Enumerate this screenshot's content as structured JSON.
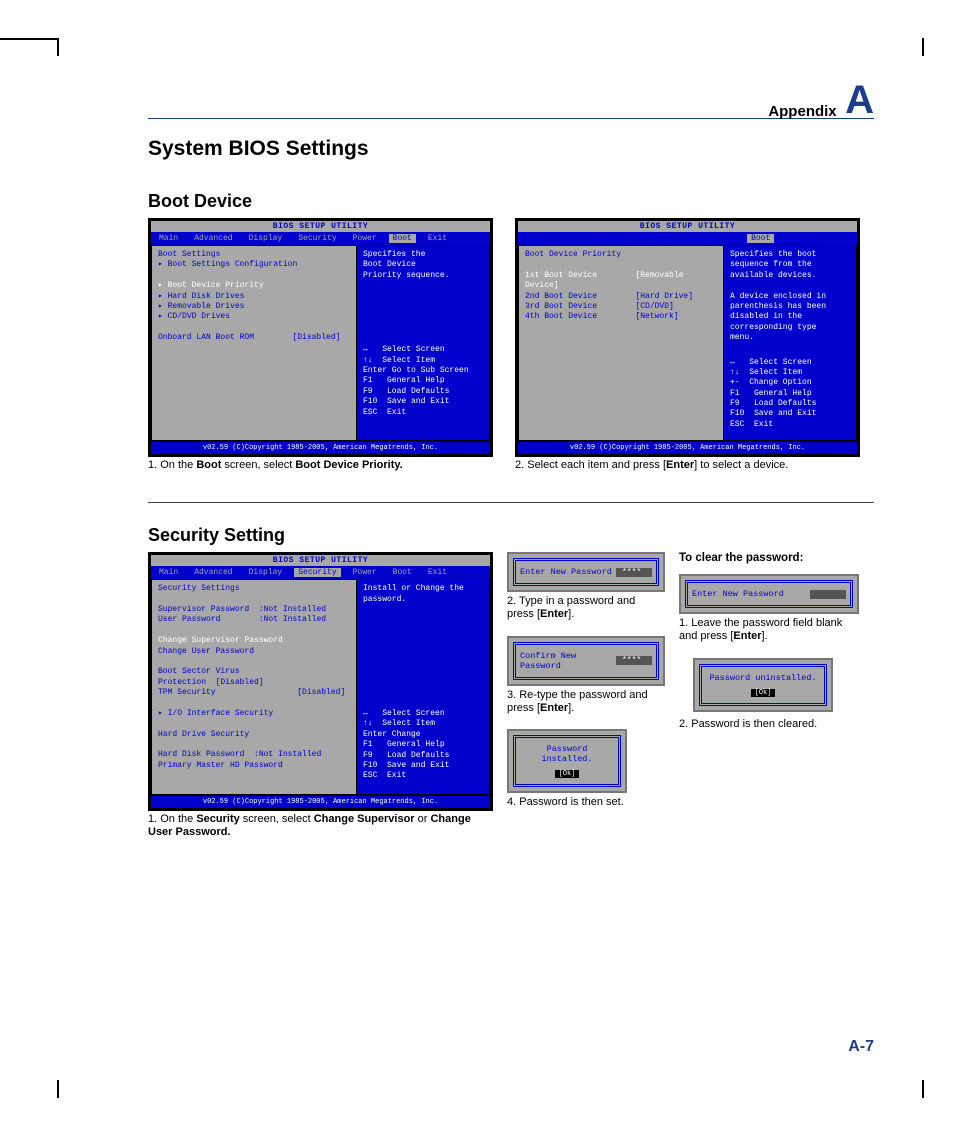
{
  "header": {
    "appendix_label": "Appendix",
    "appendix_letter": "A"
  },
  "title": "System BIOS Settings",
  "boot": {
    "heading": "Boot Device",
    "shot1": {
      "util_title": "BIOS SETUP UTILITY",
      "menu": [
        "Main",
        "Advanced",
        "Display",
        "Security",
        "Power",
        "Boot",
        "Exit"
      ],
      "menu_selected": 5,
      "left": {
        "heading": "Boot Settings",
        "items": [
          "▸ Boot Settings Configuration",
          "",
          "▸ Boot Device Priority",
          "▸ Hard Disk Drives",
          "▸ Removable Drives",
          "▸ CD/DVD Drives"
        ],
        "extra_label": "Onboard LAN Boot ROM",
        "extra_value": "[Disabled]"
      },
      "right": {
        "desc": "Specifies the\nBoot Device\nPriority sequence.",
        "keys": "↔   Select Screen\n↑↓  Select Item\nEnter Go to Sub Screen\nF1   General Help\nF9   Load Defaults\nF10  Save and Exit\nESC  Exit"
      },
      "footer": "v02.59 (C)Copyright 1985-2005, American Megatrends, Inc.",
      "caption_pre": " 1. On the ",
      "caption_b1": "Boot",
      "caption_mid": " screen, select ",
      "caption_b2": "Boot Device Priority."
    },
    "shot2": {
      "util_title": "BIOS SETUP UTILITY",
      "menu_selected_label": "Boot",
      "left": {
        "heading": "Boot Device Priority",
        "rows": [
          {
            "label": "1st Boot Device",
            "value": "[Removable Device]",
            "sel": true
          },
          {
            "label": "2nd Boot Device",
            "value": "[Hard Drive]"
          },
          {
            "label": "3rd Boot Device",
            "value": "[CD/DVD]"
          },
          {
            "label": "4th Boot Device",
            "value": "[Network]"
          }
        ]
      },
      "right": {
        "desc": "Specifies the boot\nsequence from the\navailable devices.\n\nA device enclosed in\nparenthesis has been\ndisabled in the\ncorresponding type\nmenu.",
        "keys": "↔   Select Screen\n↑↓  Select Item\n+-  Change Option\nF1   General Help\nF9   Load Defaults\nF10  Save and Exit\nESC  Exit"
      },
      "footer": "v02.59 (C)Copyright 1985-2005, American Megatrends, Inc.",
      "caption_pre": " 2. Select each item and press [",
      "caption_b1": "Enter",
      "caption_post": "] to select a device."
    }
  },
  "security": {
    "heading": "Security Setting",
    "shot": {
      "util_title": "BIOS SETUP UTILITY",
      "menu": [
        "Main",
        "Advanced",
        "Display",
        "Security",
        "Power",
        "Boot",
        "Exit"
      ],
      "menu_selected": 3,
      "left": {
        "heading": "Security Settings",
        "rows1": [
          {
            "label": "Supervisor Password",
            "value": ":Not Installed"
          },
          {
            "label": "User Password",
            "value": ":Not Installed"
          }
        ],
        "white1": "Change Supervisor Password",
        "row_after": "Change User Password",
        "rows2": [
          {
            "label": "Boot Sector Virus Protection",
            "value": "[Disabled]"
          },
          {
            "label": "TPM Security",
            "value": "[Disabled]"
          }
        ],
        "io": "▸ I/O Interface Security",
        "hd_heading": "Hard Drive Security",
        "rows3": [
          {
            "label": "Hard Disk Password",
            "value": ":Not Installed"
          },
          {
            "label": "Primary Master HD Password",
            "value": ""
          }
        ]
      },
      "right": {
        "desc": "Install or Change the\npassword.",
        "keys": "↔   Select Screen\n↑↓  Select Item\nEnter Change\nF1   General Help\nF9   Load Defaults\nF10  Save and Exit\nESC  Exit"
      },
      "footer": "v02.59 (C)Copyright 1985-2005, American Megatrends, Inc.",
      "caption_pre": " 1. On the ",
      "caption_b1": "Security",
      "caption_mid": " screen, select ",
      "caption_b2": "Change Supervisor",
      "caption_mid2": " or ",
      "caption_b3": "Change User Password."
    },
    "col2": {
      "step2_label": "Enter New Password",
      "step2_val": "****",
      "step2_text_a": "2. Type in a password and press [",
      "step2_text_b": "Enter",
      "step2_text_c": "].",
      "step3_label": "Confirm New Password",
      "step3_val": "****",
      "step3_text_a": "3. Re-type the password and press [",
      "step3_text_b": "Enter",
      "step3_text_c": "].",
      "step4_label": "Password installed.",
      "step4_ok": "[Ok]",
      "step4_text": " 4. Password is then set."
    },
    "col3": {
      "heading": "To clear the password:",
      "step1_label": "Enter New Password",
      "step1_text_a": " 1. Leave the password field blank and press [",
      "step1_text_b": "Enter",
      "step1_text_c": "].",
      "step2_label": "Password uninstalled.",
      "step2_ok": "[Ok]",
      "step2_text": "2. Password is then cleared."
    }
  },
  "page_number": "A-7"
}
